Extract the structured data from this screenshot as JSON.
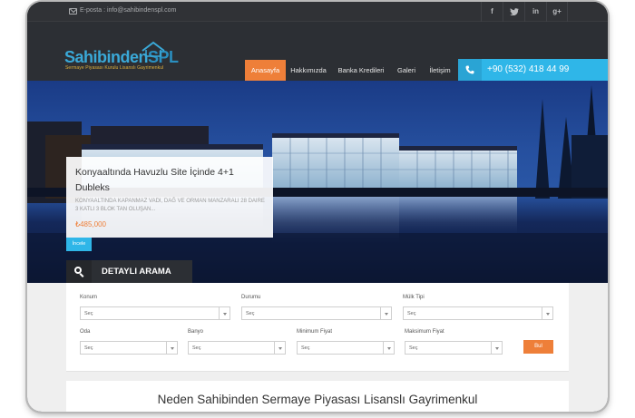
{
  "topbar": {
    "email": "E-posta : info@sahibindenspl.com",
    "social": [
      {
        "label": "f",
        "icon": "facebook-icon"
      },
      {
        "label": "t",
        "icon": "twitter-icon"
      },
      {
        "label": "in",
        "icon": "linkedin-icon"
      },
      {
        "label": "g+",
        "icon": "google-plus-icon"
      }
    ]
  },
  "header": {
    "logo_main": "Sahibinden",
    "logo_accent": "SPL",
    "logo_sub": "Sermaye Piyasası Kurulu Lisanslı Gayrimenkul",
    "nav": [
      "Anasayfa",
      "Hakkımızda",
      "Banka Kredileri",
      "Galeri",
      "İletişim"
    ],
    "phone": "+90 (532) 418 44 99"
  },
  "hero": {
    "title": "Konyaaltında Havuzlu Site İçinde 4+1 Dubleks",
    "description": "KONYAALTINDA KAPANMAZ VADI, DAĞ VE ORMAN MANZARALI 28 DAIRE 3 KATLI 3 BLOK TAN OLUŞAN...",
    "price": "₺485,000",
    "button": "İncele"
  },
  "search": {
    "title": "DETAYLI ARAMA",
    "fields_row1": [
      {
        "label": "Konum",
        "value": "Seç"
      },
      {
        "label": "Durumu",
        "value": "Seç"
      },
      {
        "label": "Mülk Tipi",
        "value": "Seç"
      }
    ],
    "fields_row2": [
      {
        "label": "Oda",
        "value": "Seç"
      },
      {
        "label": "Banyo",
        "value": "Seç"
      },
      {
        "label": "Minimum Fiyat",
        "value": "Seç"
      },
      {
        "label": "Maksimum Fiyat",
        "value": "Seç"
      }
    ],
    "button": "Bul"
  },
  "section": {
    "title": "Neden Sahibinden Sermaye Piyasası Lisanslı Gayrimenkul"
  },
  "colors": {
    "accent_orange": "#ee7f39",
    "accent_blue": "#2fb6e8",
    "dark_bg": "#2c2f34"
  }
}
